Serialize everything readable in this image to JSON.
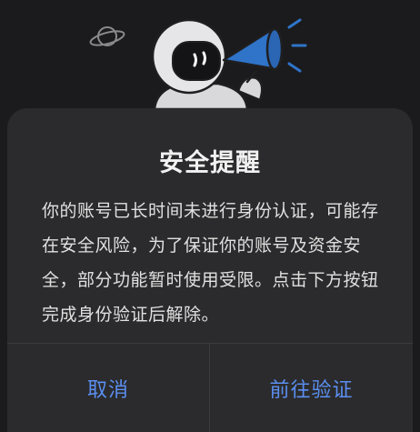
{
  "dialog": {
    "title": "安全提醒",
    "message": "你的账号已长时间未进行身份认证，可能存在安全风险，为了保证你的账号及资金安全，部分功能暂时使用受限。点击下方按钮完成身份验证后解除。",
    "cancel_label": "取消",
    "confirm_label": "前往验证"
  },
  "colors": {
    "background": "#1b1b1d",
    "dialog": "#2b2b2d",
    "title_text": "#f2f2f2",
    "body_text": "#e0e0e0",
    "button_text": "#5b8ff0",
    "megaphone": "#2f74c9"
  },
  "icons": {
    "planet": "planet-icon",
    "mascot": "astronaut-mascot",
    "megaphone": "megaphone-icon"
  }
}
